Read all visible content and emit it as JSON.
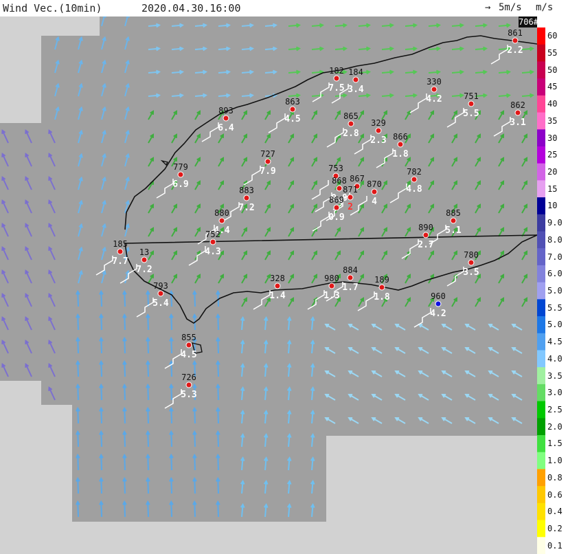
{
  "header": {
    "title": "Wind Vec.(10min)",
    "datetime": "2020.04.30.16:00",
    "scale_label": "5m/s",
    "unit": "m/s"
  },
  "station_count_badge": "706#",
  "legend": {
    "unit": "m/s",
    "labels": [
      "60",
      "55",
      "50",
      "45",
      "40",
      "35",
      "30",
      "25",
      "20",
      "15",
      "10",
      "9.0",
      "8.0",
      "7.0",
      "6.0",
      "5.0",
      "5.5",
      "5.0",
      "4.5",
      "4.0",
      "3.5",
      "3.0",
      "2.5",
      "2.0",
      "1.5",
      "1.0",
      "0.8",
      "0.6",
      "0.4",
      "0.2",
      "0.1"
    ],
    "colors": [
      "#ff0000",
      "#c8001e",
      "#c80050",
      "#c80078",
      "#ff4696",
      "#ff6ec8",
      "#8c00c8",
      "#b400dc",
      "#d264e6",
      "#e6a0f0",
      "#000096",
      "#3c3ca0",
      "#5050b4",
      "#6464c8",
      "#8282dc",
      "#a0a0f0",
      "#0046d2",
      "#1e78e6",
      "#50a0f0",
      "#82c8ff",
      "#a0f0a0",
      "#64dc64",
      "#00c800",
      "#00a000",
      "#40e040",
      "#80ff80",
      "#ffa000",
      "#ffc800",
      "#ffe100",
      "#ffff00",
      "#ffffe6"
    ]
  },
  "stations": [
    {
      "id": "861",
      "speed": "2.2"
    },
    {
      "id": "182",
      "speed": "7.5"
    },
    {
      "id": "184",
      "speed": "3.4"
    },
    {
      "id": "330",
      "speed": "4.2"
    },
    {
      "id": "751",
      "speed": "5.5"
    },
    {
      "id": "862",
      "speed": "3.1"
    },
    {
      "id": "893",
      "speed": "6.4"
    },
    {
      "id": "863",
      "speed": "4.5"
    },
    {
      "id": "865",
      "speed": "2.8"
    },
    {
      "id": "329",
      "speed": "2.3"
    },
    {
      "id": "866",
      "speed": "1.8"
    },
    {
      "id": "779",
      "speed": "6.9"
    },
    {
      "id": "727",
      "speed": "7.9"
    },
    {
      "id": "753",
      "speed": ""
    },
    {
      "id": "868",
      "speed": "0.8"
    },
    {
      "id": "867",
      "speed": ""
    },
    {
      "id": "871",
      "speed": "2"
    },
    {
      "id": "870",
      "speed": "4"
    },
    {
      "id": "869",
      "speed": "0.9"
    },
    {
      "id": "782",
      "speed": "4.8"
    },
    {
      "id": "883",
      "speed": "7.2"
    },
    {
      "id": "880",
      "speed": "4.4"
    },
    {
      "id": "752",
      "speed": "4.3"
    },
    {
      "id": "885",
      "speed": "5.1"
    },
    {
      "id": "890",
      "speed": "2.7"
    },
    {
      "id": "185",
      "speed": "7.7"
    },
    {
      "id": "13",
      "speed": "7.2"
    },
    {
      "id": "793",
      "speed": "5.4"
    },
    {
      "id": "780",
      "speed": "3.5"
    },
    {
      "id": "328",
      "speed": "1.4"
    },
    {
      "id": "980",
      "speed": "1.3"
    },
    {
      "id": "884",
      "speed": "1.7"
    },
    {
      "id": "189",
      "speed": "1.8"
    },
    {
      "id": "960",
      "speed": "4.2"
    },
    {
      "id": "855",
      "speed": "4.5"
    },
    {
      "id": "726",
      "speed": "5.3"
    }
  ]
}
